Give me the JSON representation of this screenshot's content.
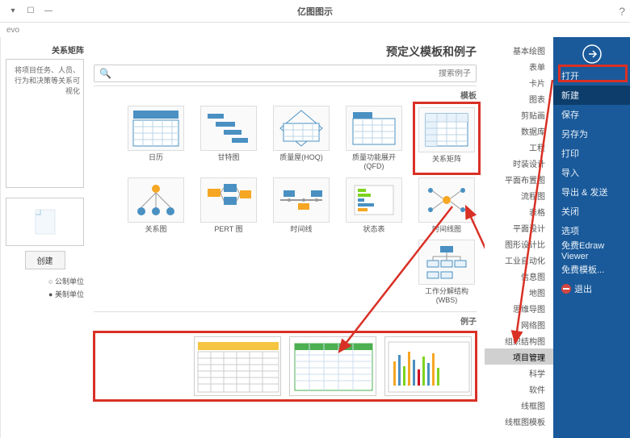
{
  "window": {
    "title": "亿图图示",
    "subbar": "evo"
  },
  "rail": {
    "items": [
      {
        "label": "打开",
        "active": false
      },
      {
        "label": "新建",
        "active": true
      },
      {
        "label": "保存",
        "active": false
      },
      {
        "label": "另存为",
        "active": false
      },
      {
        "label": "打印",
        "active": false
      },
      {
        "label": "导入",
        "active": false
      },
      {
        "label": "导出 & 发送",
        "active": false
      },
      {
        "label": "关闭",
        "active": false
      },
      {
        "label": "选项",
        "active": false
      },
      {
        "label": "免费Edraw Viewer",
        "active": false
      },
      {
        "label": "免费模板...",
        "active": false
      },
      {
        "label": "退出",
        "active": false,
        "icon": "stop"
      }
    ]
  },
  "categories": {
    "items": [
      "基本绘图",
      "表单",
      "卡片",
      "图表",
      "剪贴画",
      "数据库",
      "工程",
      "时装设计",
      "平面布置图",
      "流程图",
      "表格",
      "平面设计",
      "图形设计比",
      "工业自动化",
      "信息图",
      "地图",
      "思维导图",
      "网络图",
      "组织结构图",
      "项目管理",
      "科学",
      "软件",
      "线框图",
      "线框图模板"
    ],
    "selectedIndex": 19
  },
  "content": {
    "header": "预定义模板和例子",
    "searchPlaceholder": "搜索例子",
    "section_templates": "模板",
    "section_examples": "例子",
    "templates": [
      {
        "label": "日历"
      },
      {
        "label": "甘特图"
      },
      {
        "label": "质量屋(HOQ)"
      },
      {
        "label": "质量功能展开(QFD)"
      },
      {
        "label": "关系矩阵",
        "highlighted": true
      },
      {
        "label": "关系图"
      },
      {
        "label": "PERT 图"
      },
      {
        "label": "时间线"
      },
      {
        "label": "状态表"
      },
      {
        "label": "时间线图"
      },
      {
        "label": "工作分解结构(WBS)"
      }
    ]
  },
  "leftPanel": {
    "title": "关系矩阵",
    "desc": "将项目任务、人员、行为和决策等关系可视化",
    "createLabel": "创建",
    "radio1": "公制单位",
    "radio2": "美制单位"
  }
}
